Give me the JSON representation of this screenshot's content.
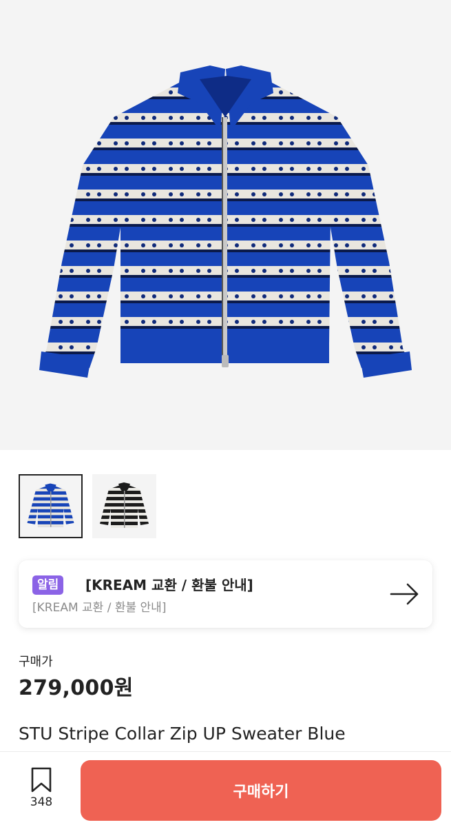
{
  "product": {
    "main_image_icon": "sweater-image",
    "thumbnails": [
      {
        "icon": "blue-stripe-sweater-thumbnail",
        "selected": true
      },
      {
        "icon": "black-stripe-sweater-thumbnail",
        "selected": false
      }
    ],
    "price_label": "구매가",
    "price": "279,000원",
    "name": "STU Stripe Collar Zip UP Sweater Blue"
  },
  "notice": {
    "badge": "알림",
    "title": "[KREAM 교환 / 환불 안내]",
    "subtitle": "[KREAM 교환 / 환불 안내]",
    "arrow_icon": "arrow-right-icon",
    "badge_color": "#8b63e6"
  },
  "bottom_bar": {
    "bookmark_icon": "bookmark-icon",
    "bookmark_count": "348",
    "buy_label": "구매하기",
    "buy_color": "#ef6253"
  }
}
